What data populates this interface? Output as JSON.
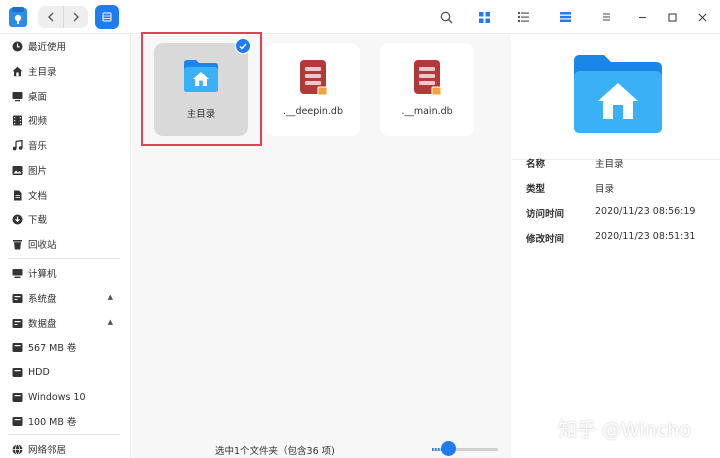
{
  "toolbar": {
    "back_icon": "chevron-left",
    "forward_icon": "chevron-right",
    "search_icon": "magnifier",
    "icon_view_icon": "grid",
    "list_view_icon": "list",
    "detail_toggle_icon": "detail-panel",
    "menu_icon": "hamburger",
    "minimize_icon": "minus",
    "maximize_icon": "square",
    "close_icon": "x",
    "accent": "#1e7cf0"
  },
  "sidebar": {
    "items": [
      {
        "label": "最近使用",
        "icon": "clock-icon"
      },
      {
        "label": "主目录",
        "icon": "home-icon"
      },
      {
        "label": "桌面",
        "icon": "desktop-icon"
      },
      {
        "label": "视频",
        "icon": "video-icon"
      },
      {
        "label": "音乐",
        "icon": "music-icon"
      },
      {
        "label": "图片",
        "icon": "picture-icon"
      },
      {
        "label": "文档",
        "icon": "document-icon"
      },
      {
        "label": "下载",
        "icon": "download-icon"
      },
      {
        "label": "回收站",
        "icon": "trash-icon"
      }
    ],
    "devices": [
      {
        "label": "计算机",
        "icon": "computer-icon"
      },
      {
        "label": "系统盘",
        "icon": "disk-icon"
      },
      {
        "label": "数据盘",
        "icon": "disk-icon"
      },
      {
        "label": "567 MB 卷",
        "icon": "disk-icon"
      },
      {
        "label": "HDD",
        "icon": "disk-icon"
      },
      {
        "label": "Windows 10",
        "icon": "disk-icon"
      },
      {
        "label": "100 MB 卷",
        "icon": "disk-icon"
      }
    ],
    "network": {
      "label": "网络邻居",
      "icon": "network-icon"
    }
  },
  "files": [
    {
      "name": "主目录",
      "type": "folder",
      "selected": true
    },
    {
      "name": ".__deepin.db",
      "type": "database"
    },
    {
      "name": ".__main.db",
      "type": "database"
    }
  ],
  "status": {
    "text": "选中1个文件夹（包含36 项)",
    "zoom_level": 0.15
  },
  "details": {
    "props": [
      {
        "key": "名称",
        "value": "主目录"
      },
      {
        "key": "类型",
        "value": "目录"
      },
      {
        "key": "访问时间",
        "value": "2020/11/23 08:56:19"
      },
      {
        "key": "修改时间",
        "value": "2020/11/23 08:51:31"
      }
    ]
  },
  "watermark": "知乎 @Wincho"
}
